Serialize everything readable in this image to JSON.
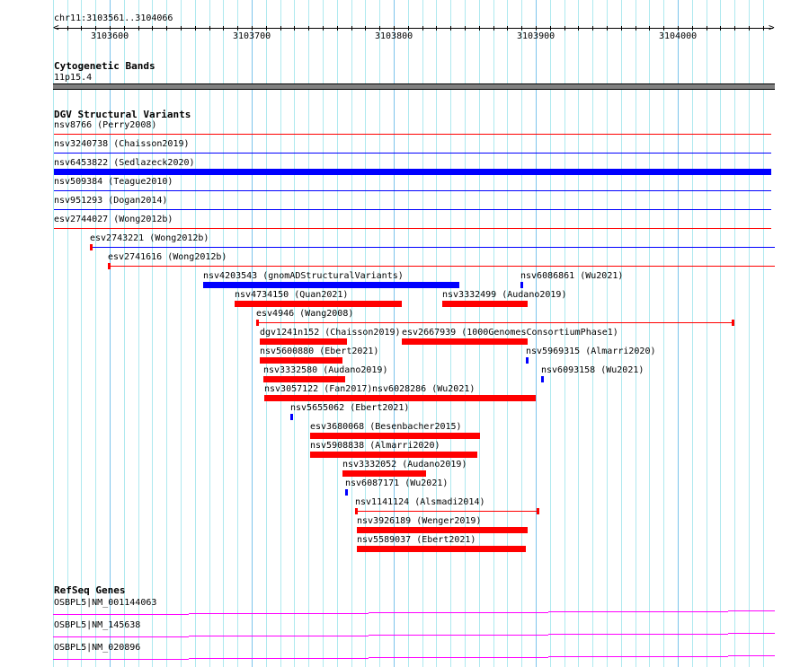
{
  "ruler": {
    "region": "chr11:3103561..3104066",
    "start": 3103561,
    "end": 3104066,
    "tick_labels": [
      "3103600",
      "3103700",
      "3103800",
      "3103900",
      "3104000"
    ]
  },
  "colors": {
    "red": "#ff0000",
    "blue": "#0000ff",
    "gene": "#ff00ff",
    "band": "#808080"
  },
  "cytoband": {
    "title": "Cytogenetic Bands",
    "label": "11p15.4"
  },
  "dgv": {
    "title": "DGV Structural Variants",
    "features": [
      {
        "label": "nsv8766 (Perry2008)",
        "row": 0,
        "start": 3103561,
        "end": 3104066,
        "color": "red",
        "style": "line"
      },
      {
        "label": "nsv3240738 (Chaisson2019)",
        "row": 1,
        "start": 3103561,
        "end": 3104066,
        "color": "blue",
        "style": "line"
      },
      {
        "label": "nsv6453822 (Sedlazeck2020)",
        "row": 2,
        "start": 3103561,
        "end": 3104066,
        "color": "blue",
        "style": "bar"
      },
      {
        "label": "nsv509384 (Teague2010)",
        "row": 3,
        "start": 3103561,
        "end": 3104066,
        "color": "blue",
        "style": "line"
      },
      {
        "label": "nsv951293 (Dogan2014)",
        "row": 4,
        "start": 3103561,
        "end": 3104066,
        "color": "blue",
        "style": "line"
      },
      {
        "label": "esv2744027 (Wong2012b)",
        "row": 5,
        "start": 3103561,
        "end": 3104066,
        "color": "red",
        "style": "line"
      },
      {
        "label": "esv2743221 (Wong2012b)",
        "row": 6,
        "start": 3103586,
        "end": 3104070,
        "color": "blue",
        "style": "span",
        "tickcolor": "red"
      },
      {
        "label": "esv2741616 (Wong2012b)",
        "row": 7,
        "start": 3103599,
        "end": 3104070,
        "color": "red",
        "style": "span"
      },
      {
        "label": "nsv4203543 (gnomADStructuralVariants)",
        "row": 8,
        "start": 3103666,
        "end": 3103846,
        "color": "blue",
        "style": "bar"
      },
      {
        "label": "nsv6086861 (Wu2021)",
        "row": 8,
        "start": 3103889,
        "end": 3103890,
        "color": "blue",
        "style": "bar"
      },
      {
        "label": "nsv4734150 (Quan2021)",
        "row": 9,
        "start": 3103688,
        "end": 3103806,
        "color": "red",
        "style": "bar"
      },
      {
        "label": "nsv3332499 (Audano2019)",
        "row": 9,
        "start": 3103834,
        "end": 3103894,
        "color": "red",
        "style": "bar"
      },
      {
        "label": "esv4946 (Wang2008)",
        "row": 10,
        "start": 3103703,
        "end": 3104039,
        "color": "red",
        "style": "span"
      },
      {
        "label": "dgv1241n152 (Chaisson2019)",
        "row": 11,
        "start": 3103706,
        "end": 3103767,
        "color": "red",
        "style": "bar"
      },
      {
        "label": "esv2667939 (1000GenomesConsortiumPhase1)",
        "row": 11,
        "start": 3103806,
        "end": 3103894,
        "color": "red",
        "style": "bar"
      },
      {
        "label": "nsv5600880 (Ebert2021)",
        "row": 12,
        "start": 3103706,
        "end": 3103764,
        "color": "red",
        "style": "bar"
      },
      {
        "label": "nsv5969315 (Almarri2020)",
        "row": 12,
        "start": 3103893,
        "end": 3103894,
        "color": "blue",
        "style": "bar"
      },
      {
        "label": "nsv3332580 (Audano2019)",
        "row": 13,
        "start": 3103708,
        "end": 3103766,
        "color": "red",
        "style": "bar"
      },
      {
        "label": "nsv6093158 (Wu2021)",
        "row": 13,
        "start": 3103904,
        "end": 3103906,
        "color": "blue",
        "style": "bar"
      },
      {
        "label": "nsv3057122 (Fan2017)",
        "row": 14,
        "start": 3103709,
        "end": 3103785,
        "color": "red",
        "style": "bar"
      },
      {
        "label": "nsv6028286 (Wu2021)",
        "row": 14,
        "start": 3103785,
        "end": 3103900,
        "color": "red",
        "style": "bar"
      },
      {
        "label": "nsv5655062 (Ebert2021)",
        "row": 15,
        "start": 3103727,
        "end": 3103729,
        "color": "blue",
        "style": "bar"
      },
      {
        "label": "esv3680068 (Besenbacher2015)",
        "row": 16,
        "start": 3103741,
        "end": 3103861,
        "color": "red",
        "style": "bar"
      },
      {
        "label": "nsv5908838 (Almarri2020)",
        "row": 17,
        "start": 3103741,
        "end": 3103859,
        "color": "red",
        "style": "bar"
      },
      {
        "label": "nsv3332052 (Audano2019)",
        "row": 18,
        "start": 3103764,
        "end": 3103823,
        "color": "red",
        "style": "bar"
      },
      {
        "label": "nsv6087171 (Wu2021)",
        "row": 19,
        "start": 3103766,
        "end": 3103768,
        "color": "blue",
        "style": "bar"
      },
      {
        "label": "nsv1141124 (Alsmadi2014)",
        "row": 20,
        "start": 3103773,
        "end": 3103902,
        "color": "red",
        "style": "span"
      },
      {
        "label": "nsv3926189 (Wenger2019)",
        "row": 21,
        "start": 3103774,
        "end": 3103894,
        "color": "red",
        "style": "bar"
      },
      {
        "label": "nsv5589037 (Ebert2021)",
        "row": 22,
        "start": 3103774,
        "end": 3103893,
        "color": "red",
        "style": "bar"
      }
    ]
  },
  "refseq": {
    "title": "RefSeq Genes",
    "genes": [
      {
        "label": "OSBPL5|NM_001144063"
      },
      {
        "label": "OSBPL5|NM_145638"
      },
      {
        "label": "OSBPL5|NM_020896"
      }
    ]
  }
}
